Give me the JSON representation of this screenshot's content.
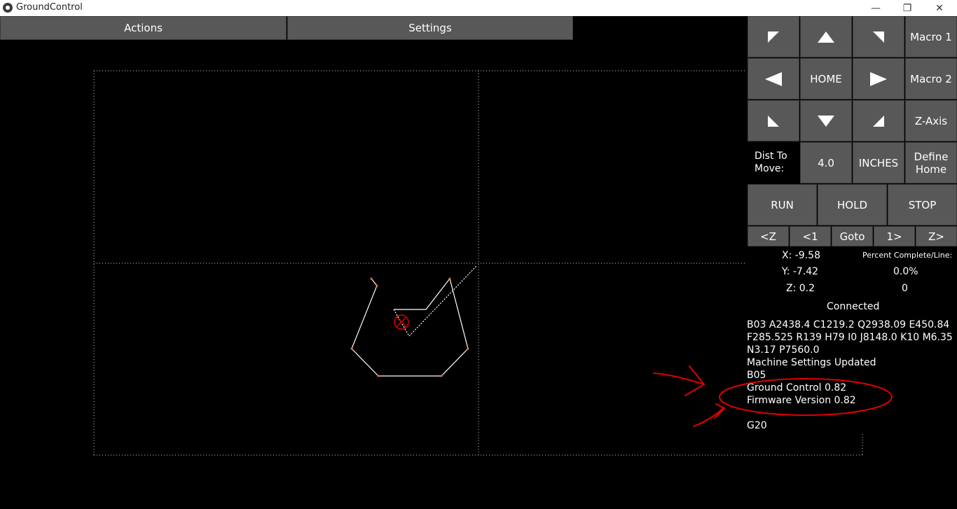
{
  "window": {
    "title": "GroundControl",
    "minimize": "—",
    "maximize": "❐",
    "close": "✕"
  },
  "menu": {
    "actions": "Actions",
    "settings": "Settings"
  },
  "jog": {
    "home": "HOME",
    "macro1": "Macro 1",
    "macro2": "Macro 2",
    "zaxis": "Z-Axis",
    "dist_label": "Dist To\nMove:",
    "dist_value": "4.0",
    "units": "INCHES",
    "define_home": "Define\nHome"
  },
  "run_controls": {
    "run": "RUN",
    "hold": "HOLD",
    "stop": "STOP"
  },
  "line_controls": {
    "z_back": "<Z",
    "one_back": "<1",
    "goto": "Goto",
    "one_fwd": "1>",
    "z_fwd": "Z>"
  },
  "position": {
    "x": "X: -9.58",
    "y": "Y: -7.42",
    "z": "Z: 0.2"
  },
  "progress": {
    "label": "Percent Complete/Line:",
    "percent": "0.0%",
    "line": "0"
  },
  "status": "Connected",
  "console": [
    "B03 A2438.4 C1219.2 Q2938.09 E450.84",
    "F285.525 R139 H79 I0 J8148.0 K10 M6.35",
    "N3.17 P7560.0",
    "Machine Settings Updated",
    "B05",
    "Ground Control 0.82",
    "Firmware Version 0.82",
    "G20"
  ],
  "colors": {
    "button": "#585858",
    "background": "#000000",
    "annotation": "#e00000",
    "toolpath": "#ffffff",
    "marker": "#e00000"
  }
}
